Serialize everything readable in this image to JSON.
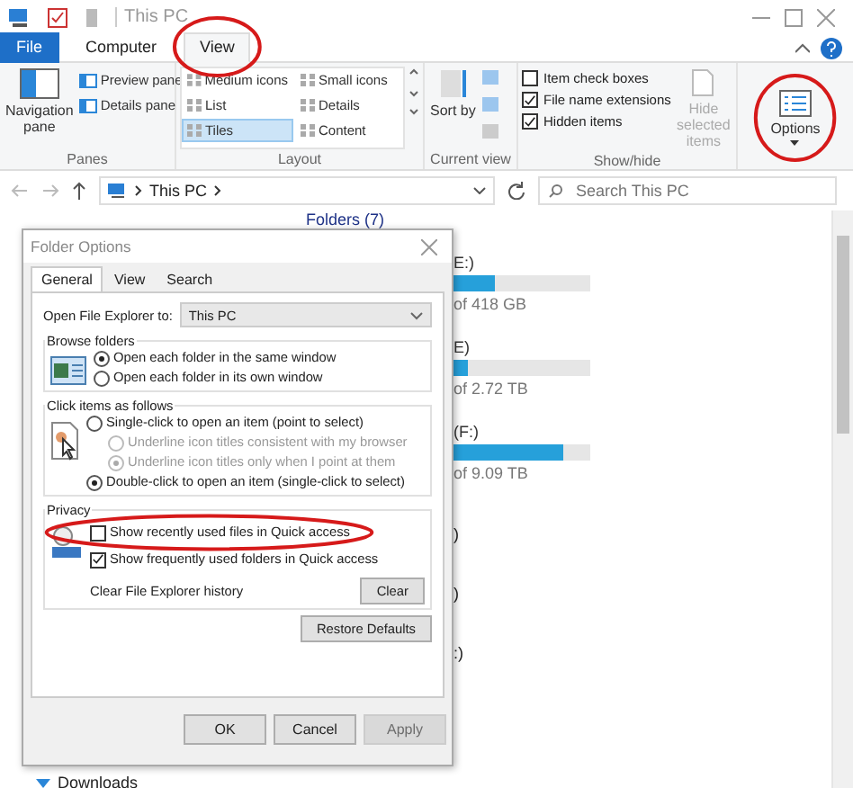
{
  "window": {
    "title": "This PC"
  },
  "ribbon_tabs": [
    {
      "label": "File",
      "kind": "file",
      "selected": false
    },
    {
      "label": "Computer",
      "kind": "tab",
      "selected": false
    },
    {
      "label": "View",
      "kind": "tab",
      "selected": true
    }
  ],
  "ribbon": {
    "panes": {
      "label": "Panes",
      "navigation": "Navigation pane",
      "items": [
        "Preview pane",
        "Details pane"
      ]
    },
    "layout": {
      "label": "Layout",
      "items": [
        {
          "label": "Medium icons",
          "selected": false
        },
        {
          "label": "Small icons",
          "selected": false
        },
        {
          "label": "List",
          "selected": false
        },
        {
          "label": "Details",
          "selected": false
        },
        {
          "label": "Tiles",
          "selected": true
        },
        {
          "label": "Content",
          "selected": false
        }
      ]
    },
    "current_view": {
      "label": "Current view",
      "sort": "Sort by"
    },
    "show_hide": {
      "label": "Show/hide",
      "checks": [
        {
          "label": "Item check boxes",
          "checked": false
        },
        {
          "label": "File name extensions",
          "checked": true
        },
        {
          "label": "Hidden items",
          "checked": true
        }
      ],
      "hide_selected": "Hide selected items"
    },
    "options": "Options"
  },
  "address": {
    "path": "This PC",
    "search_placeholder": "Search This PC"
  },
  "content": {
    "header": "Folders (7)",
    "drives": [
      {
        "name": "E:)",
        "level": 0.3,
        "size": "of 418 GB"
      },
      {
        "name": "E)",
        "level": 0.11,
        "size": "of 2.72 TB"
      },
      {
        "name": "(F:)",
        "level": 0.8,
        "size": "of 9.09 TB"
      }
    ],
    "fragments": [
      ")",
      ")",
      ":)"
    ],
    "nav_item": "Downloads"
  },
  "dialog": {
    "title": "Folder Options",
    "tabs": [
      {
        "label": "General",
        "selected": true
      },
      {
        "label": "View",
        "selected": false
      },
      {
        "label": "Search",
        "selected": false
      }
    ],
    "open_to_label": "Open File Explorer to:",
    "open_to_value": "This PC",
    "groups": [
      {
        "title": "Browse folders",
        "options": [
          {
            "kind": "radio",
            "label": "Open each folder in the same window",
            "checked": true,
            "disabled": false
          },
          {
            "kind": "radio",
            "label": "Open each folder in its own window",
            "checked": false,
            "disabled": false
          }
        ]
      },
      {
        "title": "Click items as follows",
        "options": [
          {
            "kind": "radio",
            "label": "Single-click to open an item (point to select)",
            "checked": false,
            "disabled": false,
            "children": [
              {
                "kind": "radio",
                "label": "Underline icon titles consistent with my browser",
                "checked": false,
                "disabled": true
              },
              {
                "kind": "radio",
                "label": "Underline icon titles only when I point at them",
                "checked": true,
                "disabled": true
              }
            ]
          },
          {
            "kind": "radio",
            "label": "Double-click to open an item (single-click to select)",
            "checked": true,
            "disabled": false
          }
        ]
      },
      {
        "title": "Privacy",
        "options": [
          {
            "kind": "checkbox",
            "label": "Show recently used files in Quick access",
            "checked": false,
            "disabled": false
          },
          {
            "kind": "checkbox",
            "label": "Show frequently used folders in Quick access",
            "checked": true,
            "disabled": false
          }
        ],
        "clear_label": "Clear File Explorer history",
        "clear_button": "Clear"
      }
    ],
    "restore": "Restore Defaults",
    "buttons": [
      {
        "label": "OK",
        "disabled": false
      },
      {
        "label": "Cancel",
        "disabled": false
      },
      {
        "label": "Apply",
        "disabled": true
      }
    ]
  }
}
